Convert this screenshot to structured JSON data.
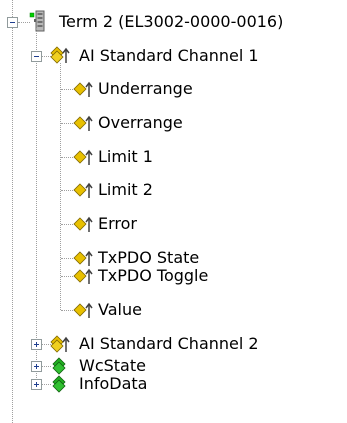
{
  "tree": {
    "root": {
      "label": "Term 2 (EL3002-0000-0016)",
      "icon": "terminal-module-icon",
      "expanded": true,
      "children": [
        {
          "label": "AI Standard Channel 1",
          "icon": "input-group-icon",
          "expanded": true,
          "children": [
            {
              "label": "Underrange",
              "icon": "input-variable-icon"
            },
            {
              "label": "Overrange",
              "icon": "input-variable-icon"
            },
            {
              "label": "Limit 1",
              "icon": "input-variable-icon"
            },
            {
              "label": "Limit 2",
              "icon": "input-variable-icon"
            },
            {
              "label": "Error",
              "icon": "input-variable-icon"
            },
            {
              "label": "TxPDO State",
              "icon": "input-variable-icon"
            },
            {
              "label": "TxPDO Toggle",
              "icon": "input-variable-icon"
            },
            {
              "label": "Value",
              "icon": "input-variable-icon"
            }
          ]
        },
        {
          "label": "AI Standard Channel 2",
          "icon": "input-group-icon",
          "expanded": false
        },
        {
          "label": "WcState",
          "icon": "status-group-icon",
          "expanded": false
        },
        {
          "label": "InfoData",
          "icon": "status-group-icon",
          "expanded": false
        }
      ]
    }
  }
}
